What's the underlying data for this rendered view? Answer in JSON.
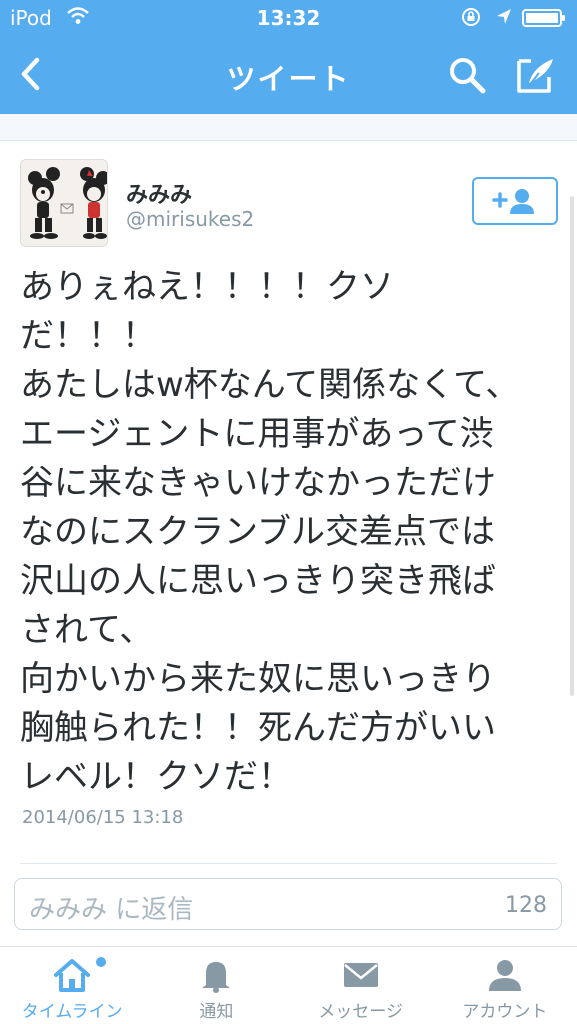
{
  "status_bar": {
    "carrier": "iPod",
    "time": "13:32"
  },
  "nav": {
    "title": "ツイート",
    "icons": {
      "back": "chevron-left-icon",
      "search": "search-icon",
      "compose": "compose-icon"
    }
  },
  "tweet": {
    "user_name": "みみみ",
    "handle": "@mirisukes2",
    "lines": [
      "ありぇねえ！！！！クソ",
      "だ！！！",
      "あたしはw杯なんて関係なくて、",
      "エージェントに用事があって渋",
      "谷に来なきゃいけなかっただけ",
      "なのにスクランブル交差点では",
      "沢山の人に思いっきり突き飛ば",
      "されて、",
      "向かいから来た奴に思いっきり",
      "胸触られた！！死んだ方がいい",
      "レベル！クソだ！"
    ],
    "timestamp": "2014/06/15 13:18"
  },
  "reply": {
    "placeholder": "みみみ に返信",
    "remaining_chars": "128"
  },
  "tabs": [
    {
      "label": "タイムライン",
      "icon": "home-icon",
      "active": true
    },
    {
      "label": "通知",
      "icon": "bell-icon",
      "active": false
    },
    {
      "label": "メッセージ",
      "icon": "envelope-icon",
      "active": false
    },
    {
      "label": "アカウント",
      "icon": "person-icon",
      "active": false
    }
  ],
  "colors": {
    "brand": "#55acee",
    "text": "#292f33",
    "muted": "#8899a6"
  }
}
